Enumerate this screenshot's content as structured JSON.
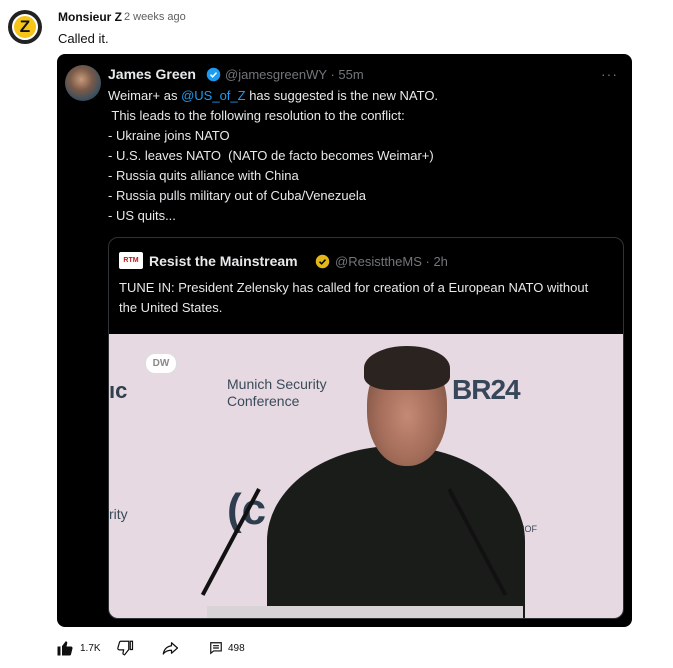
{
  "comment": {
    "author": "Monsieur Z",
    "time": "2 weeks ago",
    "text": "Called it.",
    "avatar_letter": "Z"
  },
  "tweet": {
    "name": "James Green",
    "handle_time": "@jamesgreenWY · 55m",
    "line1_pre": "Weimar+ as ",
    "line1_mention": "@US_of_Z",
    "line1_post": " has suggested is the new NATO.",
    "lines": [
      " This leads to the following resolution to the conflict:",
      "- Ukraine joins NATO",
      "- U.S. leaves NATO  (NATO de facto becomes Weimar+)",
      "- Russia quits alliance with China",
      "- Russia pulls military out of Cuba/Venezuela",
      "- US quits..."
    ],
    "more": "···"
  },
  "quote": {
    "logo_text": "RTM",
    "name": "Resist the Mainstream",
    "handle_time": "@ResisttheMS · 2h",
    "text": "TUNE IN: President Zelensky has called for creation of a European NATO without the United States.",
    "image": {
      "dw": "DW",
      "left_edge": "ıc",
      "conference_line1": "Munich Security",
      "conference_line2": "Conference",
      "br24": "BR24",
      "rity": "rity",
      "cmark": "(c m",
      "hof": "HOF"
    }
  },
  "actions": {
    "likes": "1.7K",
    "replies": "498"
  },
  "colors": {
    "tweet_bg": "#000000",
    "mention": "#1d9bf0",
    "verified_blue": "#1d9bf0",
    "verified_gold": "#e2b719"
  }
}
